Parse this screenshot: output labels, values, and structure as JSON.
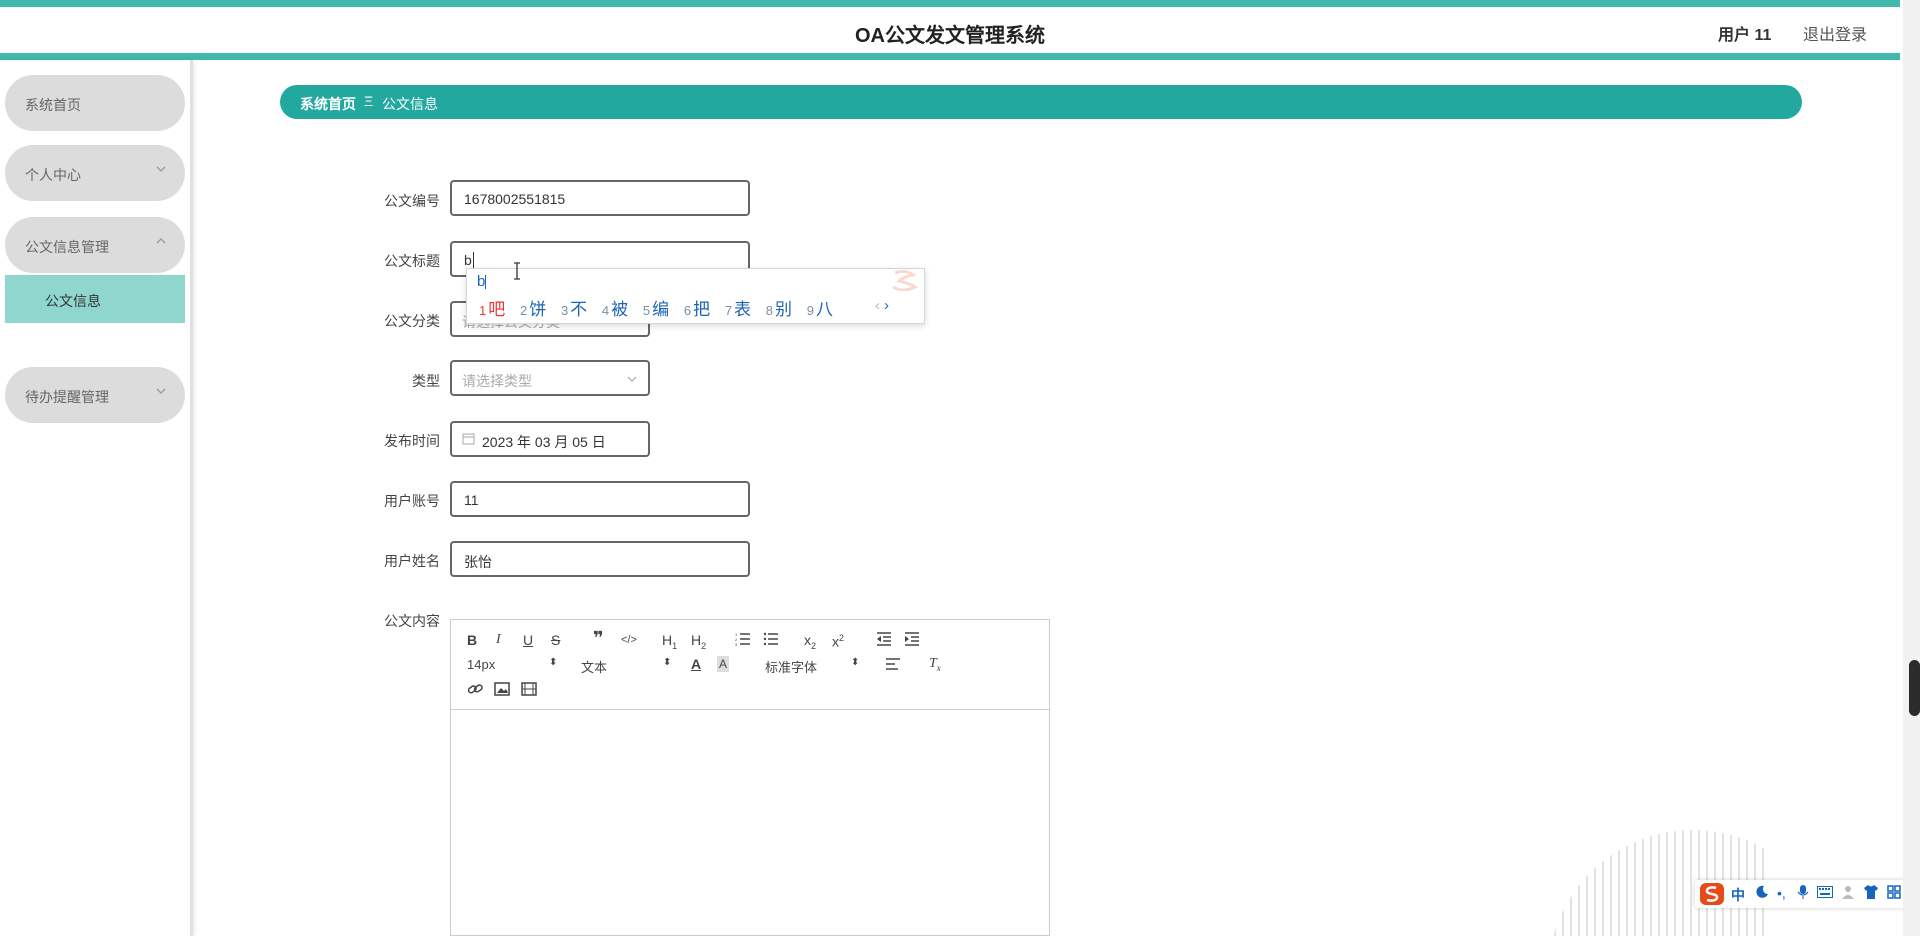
{
  "header": {
    "app_title": "OA公文发文管理系统",
    "user_name": "用户 11",
    "logout_label": "退出登录"
  },
  "sidebar": {
    "items": [
      {
        "label": "系统首页"
      },
      {
        "label": "个人中心"
      },
      {
        "label": "公文信息管理"
      },
      {
        "label": "待办提醒管理"
      }
    ],
    "sub_active": "公文信息"
  },
  "breadcrumb": {
    "home": "系统首页",
    "separator": "Ξ",
    "current": "公文信息"
  },
  "form": {
    "doc_number": {
      "label": "公文编号",
      "value": "1678002551815"
    },
    "doc_title": {
      "label": "公文标题",
      "value": "b"
    },
    "doc_category": {
      "label": "公文分类",
      "placeholder": "请选择公文分类"
    },
    "doc_type": {
      "label": "类型",
      "placeholder": "请选择类型"
    },
    "publish_time": {
      "label": "发布时间",
      "value": "2023 年 03 月 05 日"
    },
    "user_account": {
      "label": "用户账号",
      "value": "11"
    },
    "user_name": {
      "label": "用户姓名",
      "value": "张怡"
    },
    "doc_content": {
      "label": "公文内容"
    }
  },
  "ime_popup": {
    "input": "b",
    "candidates": [
      {
        "num": "1",
        "text": "吧"
      },
      {
        "num": "2",
        "text": "饼"
      },
      {
        "num": "3",
        "text": "不"
      },
      {
        "num": "4",
        "text": "被"
      },
      {
        "num": "5",
        "text": "编"
      },
      {
        "num": "6",
        "text": "把"
      },
      {
        "num": "7",
        "text": "表"
      },
      {
        "num": "8",
        "text": "别"
      },
      {
        "num": "9",
        "text": "八"
      }
    ],
    "prev": "‹",
    "next": "›"
  },
  "editor": {
    "font_size": "14px",
    "text_type": "文本",
    "font_family": "标准字体"
  },
  "ime_bar": {
    "mode": "中"
  },
  "colors": {
    "accent": "#23a89f",
    "header_line": "#3fb8ae",
    "nav_active": "#8fd6cf",
    "nav_bg": "#dcdcdc"
  }
}
